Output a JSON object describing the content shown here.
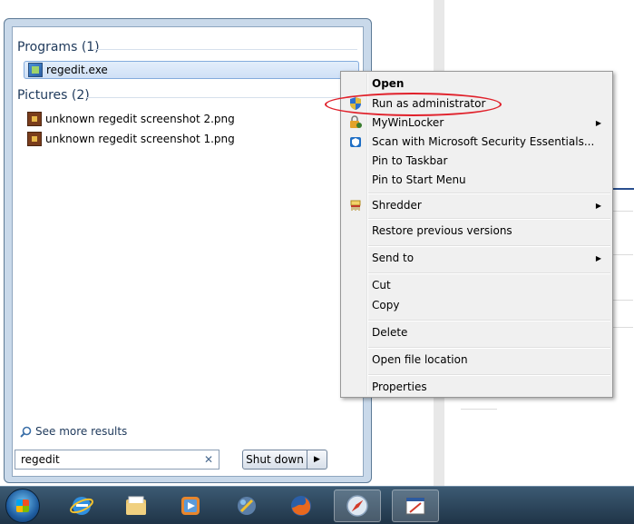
{
  "start_menu": {
    "programs_header": "Programs (1)",
    "programs": [
      {
        "label": "regedit.exe",
        "icon": "regedit-icon"
      }
    ],
    "pictures_header": "Pictures (2)",
    "pictures": [
      {
        "label": "unknown regedit screenshot 2.png",
        "icon": "png-file-icon"
      },
      {
        "label": "unknown regedit screenshot 1.png",
        "icon": "png-file-icon"
      }
    ],
    "see_more": "See more results",
    "search": {
      "value": "regedit",
      "clear": "✕"
    },
    "shutdown_label": "Shut down",
    "shutdown_arrow": "▶"
  },
  "context_menu": {
    "items": [
      {
        "label": "Open"
      },
      {
        "label": "Run as administrator"
      },
      {
        "label": "MyWinLocker"
      },
      {
        "label": "Scan with Microsoft Security Essentials..."
      },
      {
        "label": "Pin to Taskbar"
      },
      {
        "label": "Pin to Start Menu"
      },
      {
        "label": "Shredder"
      },
      {
        "label": "Restore previous versions"
      },
      {
        "label": "Send to"
      },
      {
        "label": "Cut"
      },
      {
        "label": "Copy"
      },
      {
        "label": "Delete"
      },
      {
        "label": "Open file location"
      },
      {
        "label": "Properties"
      }
    ],
    "submenu_arrow": "▶"
  },
  "colors": {
    "highlight_circle": "#e0212b",
    "taskbar": "#2b4a63",
    "group_title": "#1e395b"
  }
}
